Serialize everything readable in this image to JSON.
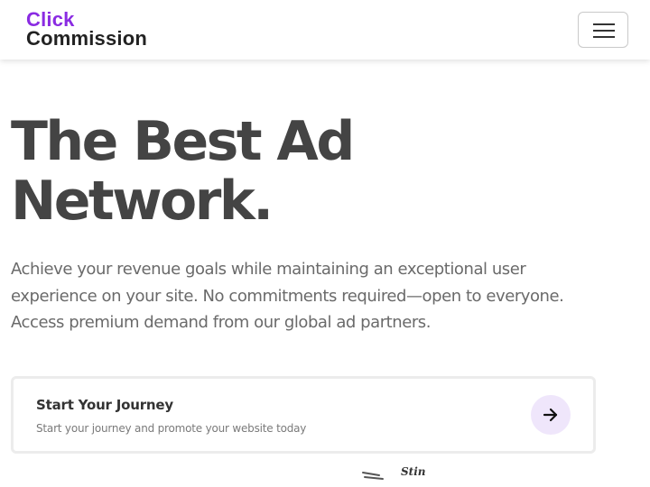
{
  "navbar": {
    "logo_line1": "Click",
    "logo_line2": "Commission",
    "menu_icon": "hamburger-icon"
  },
  "hero": {
    "title_line1": "The Best Ad",
    "title_line2": "Network.",
    "description_lines": [
      "Achieve your revenue goals while maintaining an exceptional user",
      "experience on your site. No commitments required—open to everyone.",
      "Access premium demand from our global ad partners."
    ]
  },
  "cta": {
    "title": "Start Your Journey",
    "subtitle": "Start your journey and promote your website today",
    "icon": "arrow-right-icon"
  },
  "decoration": {
    "text": "Stin"
  },
  "colors": {
    "brand_purple": "#8a2be2",
    "heading": "#444444",
    "body_text": "#6a6a6a",
    "arrow_bg": "#efe6fb"
  }
}
